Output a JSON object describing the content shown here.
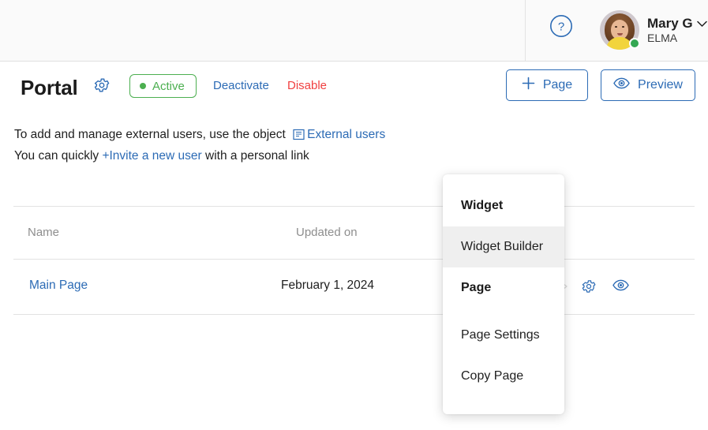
{
  "topbar": {
    "help_icon": "question-circle-icon",
    "user": {
      "name": "Mary G",
      "org": "ELMA",
      "chevron": "chevron-down-icon",
      "status": "online"
    }
  },
  "page_header": {
    "title": "Portal",
    "settings_icon": "gear-icon",
    "status_badge": "Active",
    "deactivate_label": "Deactivate",
    "disable_label": "Disable",
    "add_page_label": "Page",
    "add_page_icon": "plus-icon",
    "preview_label": "Preview",
    "preview_icon": "eye-icon"
  },
  "info": {
    "line1_prefix": "To add and manage external users, use the object ",
    "line1_link": "External users",
    "line1_icon": "object-book-icon",
    "line2_prefix": "You can quickly ",
    "line2_link": "+Invite a new user",
    "line2_suffix": " with a personal link"
  },
  "table": {
    "columns": [
      "Name",
      "Updated on"
    ],
    "rows": [
      {
        "name": "Main Page",
        "updated_on": "February 1, 2024",
        "actions": [
          "chevron-right-icon",
          "gear-icon",
          "eye-icon"
        ]
      }
    ]
  },
  "dropdown": {
    "groups": [
      {
        "label": "Widget",
        "items": [
          {
            "label": "Widget Builder",
            "hovered": true
          }
        ]
      },
      {
        "label": "Page",
        "items": [
          {
            "label": "Page Settings",
            "hovered": false
          },
          {
            "label": "Copy Page",
            "hovered": false
          }
        ]
      }
    ]
  },
  "colors": {
    "accent_blue": "#2c6bb5",
    "success_green": "#4caf50",
    "danger_red": "#f03f3f",
    "topbar_bg": "#fafafa",
    "hover_bg": "#efefef",
    "divider": "#e2e2e2"
  }
}
